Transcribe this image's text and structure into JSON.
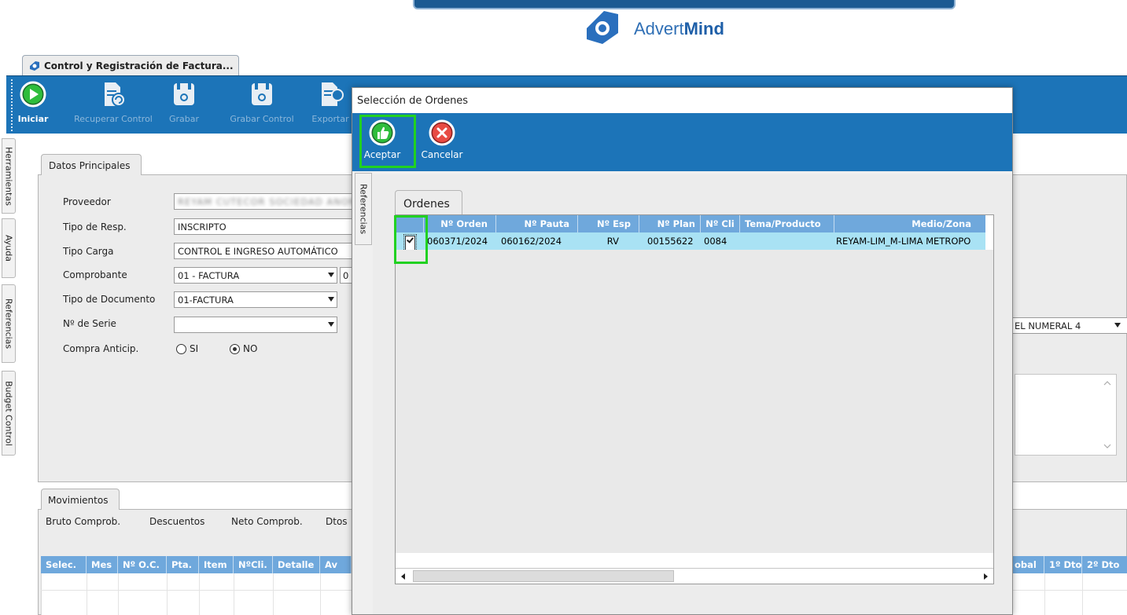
{
  "brand": {
    "name_regular": "Advert",
    "name_bold": "Mind",
    "accent_color": "#1c74b8"
  },
  "app_tab": {
    "title": "Control y Registración de Factura..."
  },
  "toolbar": {
    "items": [
      {
        "label": "Iniciar",
        "icon": "play-icon"
      },
      {
        "label": "Recuperar Control",
        "icon": "recover-doc-icon"
      },
      {
        "label": "Grabar",
        "icon": "save-icon"
      },
      {
        "label": "Grabar Control",
        "icon": "save-control-icon"
      },
      {
        "label": "Exportar",
        "icon": "export-icon"
      }
    ]
  },
  "side_tabs": [
    "Herramientas",
    "Ayuda",
    "Referencias",
    "Budget Control"
  ],
  "datos": {
    "tab_label": "Datos Principales",
    "proveedor_label": "Proveedor",
    "proveedor_value": "REYAM CUTECOR SOCIEDAD ANONI",
    "tipo_resp_label": "Tipo de Resp.",
    "tipo_resp_value": "INSCRIPTO",
    "tipo_carga_label": "Tipo Carga",
    "tipo_carga_value": "CONTROL E INGRESO AUTOMÁTICO",
    "comprobante_label": "Comprobante",
    "comprobante_value": "01 - FACTURA",
    "comprobante_extra": "0",
    "tipo_doc_label": "Tipo de Documento",
    "tipo_doc_value": "01-FACTURA",
    "serie_label": "Nº de Serie",
    "serie_value": "",
    "compra_label": "Compra Anticip.",
    "opt_si": "SI",
    "opt_no": "NO",
    "right_combo_value": "EL NUMERAL 4"
  },
  "movimientos": {
    "tab_label": "Movimientos",
    "labels": [
      "Bruto Comprob.",
      "Descuentos",
      "Neto Comprob.",
      "Dtos"
    ],
    "columns": [
      "Selec.",
      "Mes",
      "Nº O.C.",
      "Pta.",
      "Item",
      "NºCli.",
      "Detalle",
      "Av"
    ],
    "right_columns": [
      "obal",
      "1º Dto",
      "2º Dto"
    ]
  },
  "dialog": {
    "title": "Selección de Ordenes",
    "accept_label": "Aceptar",
    "cancel_label": "Cancelar",
    "side_tab": "Referencias",
    "ordenes_tab": "Ordenes",
    "columns": [
      "",
      "Nº Orden",
      "Nº Pauta",
      "Nº Esp",
      "Nº Plan",
      "Nº Cli",
      "Tema/Producto",
      "Medio/Zona"
    ],
    "rows": [
      {
        "selected": true,
        "orden": "060371/2024",
        "pauta": "060162/2024",
        "esp": "RV",
        "plan": "00155622",
        "cli": "0084",
        "tema": "",
        "medio": "REYAM-LIM_M-LIMA METROPO"
      }
    ]
  },
  "colors": {
    "toolbar_blue": "#1c74b8",
    "header_blue": "#6fa8dc",
    "row_selected": "#a9e2f4",
    "highlight_green": "#21d121"
  }
}
